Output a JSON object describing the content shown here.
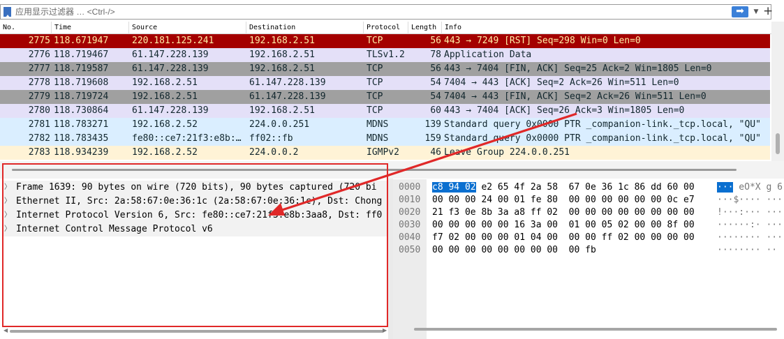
{
  "filter": {
    "placeholder": "应用显示过滤器 … <Ctrl-/>",
    "apply_icon": "arrow-right-icon",
    "dropdown_icon": "chevron-down-icon",
    "add_label": "+"
  },
  "packet_list": {
    "columns": [
      "No.",
      "Time",
      "Source",
      "Destination",
      "Protocol",
      "Length",
      "Info"
    ],
    "rows": [
      {
        "no": "2775",
        "time": "118.671947",
        "src": "220.181.125.241",
        "dst": "192.168.2.51",
        "proto": "TCP",
        "len": "56",
        "info": "443 → 7249 [RST] Seq=298 Win=0 Len=0",
        "bg": "#a40000",
        "fg": "#fff0a8"
      },
      {
        "no": "2776",
        "time": "118.719467",
        "src": "61.147.228.139",
        "dst": "192.168.2.51",
        "proto": "TLSv1.2",
        "len": "78",
        "info": "Application Data",
        "bg": "#e4e0f8",
        "fg": "#12272e"
      },
      {
        "no": "2777",
        "time": "118.719587",
        "src": "61.147.228.139",
        "dst": "192.168.2.51",
        "proto": "TCP",
        "len": "56",
        "info": "443 → 7404 [FIN, ACK] Seq=25 Ack=2 Win=1805 Len=0",
        "bg": "#a0a0a0",
        "fg": "#12272e"
      },
      {
        "no": "2778",
        "time": "118.719608",
        "src": "192.168.2.51",
        "dst": "61.147.228.139",
        "proto": "TCP",
        "len": "54",
        "info": "7404 → 443 [ACK] Seq=2 Ack=26 Win=511 Len=0",
        "bg": "#e4e0f8",
        "fg": "#12272e"
      },
      {
        "no": "2779",
        "time": "118.719724",
        "src": "192.168.2.51",
        "dst": "61.147.228.139",
        "proto": "TCP",
        "len": "54",
        "info": "7404 → 443 [FIN, ACK] Seq=2 Ack=26 Win=511 Len=0",
        "bg": "#a0a0a0",
        "fg": "#12272e"
      },
      {
        "no": "2780",
        "time": "118.730864",
        "src": "61.147.228.139",
        "dst": "192.168.2.51",
        "proto": "TCP",
        "len": "60",
        "info": "443 → 7404 [ACK] Seq=26 Ack=3 Win=1805 Len=0",
        "bg": "#e4e0f8",
        "fg": "#12272e"
      },
      {
        "no": "2781",
        "time": "118.783271",
        "src": "192.168.2.52",
        "dst": "224.0.0.251",
        "proto": "MDNS",
        "len": "139",
        "info": "Standard query 0x0000 PTR _companion-link._tcp.local, \"QU\"",
        "bg": "#daeeff",
        "fg": "#12272e"
      },
      {
        "no": "2782",
        "time": "118.783435",
        "src": "fe80::ce7:21f3:e8b:…",
        "dst": "ff02::fb",
        "proto": "MDNS",
        "len": "159",
        "info": "Standard query 0x0000 PTR _companion-link._tcp.local, \"QU\"",
        "bg": "#daeeff",
        "fg": "#12272e"
      },
      {
        "no": "2783",
        "time": "118.934239",
        "src": "192.168.2.52",
        "dst": "224.0.0.2",
        "proto": "IGMPv2",
        "len": "46",
        "info": "Leave Group 224.0.0.251",
        "bg": "#fff3d6",
        "fg": "#12272e"
      }
    ]
  },
  "details": {
    "items": [
      {
        "arrow": "chevron-right-icon",
        "text": "Frame 1639: 90 bytes on wire (720 bits), 90 bytes captured (720 bi"
      },
      {
        "arrow": "chevron-right-icon",
        "text": "Ethernet II, Src: 2a:58:67:0e:36:1c (2a:58:67:0e:36:1c), Dst: Chong"
      },
      {
        "arrow": "chevron-right-icon",
        "text": "Internet Protocol Version 6, Src: fe80::ce7:21f3:e8b:3aa8, Dst: ff0"
      },
      {
        "arrow": "chevron-right-icon",
        "text": "Internet Control Message Protocol v6"
      }
    ]
  },
  "bytes": {
    "rows": [
      {
        "offset": "0000",
        "hl": "c8 94 02",
        "hex": " e2 65 4f 2a 58  67 0e 36 1c 86 dd 60 00",
        "ascii_hl": "···",
        "ascii": " eO*X g 6"
      },
      {
        "offset": "0010",
        "hl": "",
        "hex": "00 00 00 24 00 01 fe 80  00 00 00 00 00 00 0c e7",
        "ascii_hl": "",
        "ascii": "···$···· ······"
      },
      {
        "offset": "0020",
        "hl": "",
        "hex": "21 f3 0e 8b 3a a8 ff 02  00 00 00 00 00 00 00 00",
        "ascii_hl": "",
        "ascii": "!···:··· ·······"
      },
      {
        "offset": "0030",
        "hl": "",
        "hex": "00 00 00 00 00 16 3a 00  01 00 05 02 00 00 8f 00",
        "ascii_hl": "",
        "ascii": "······:· ·······"
      },
      {
        "offset": "0040",
        "hl": "",
        "hex": "f7 02 00 00 00 01 04 00  00 00 ff 02 00 00 00 00",
        "ascii_hl": "",
        "ascii": "········ ·······"
      },
      {
        "offset": "0050",
        "hl": "",
        "hex": "00 00 00 00 00 00 00 00  00 fb",
        "ascii_hl": "",
        "ascii": "········ ··"
      }
    ]
  },
  "colors": {
    "annotation": "#e02828",
    "selected_row": "#a40000",
    "highlight": "#0a6fd0"
  }
}
